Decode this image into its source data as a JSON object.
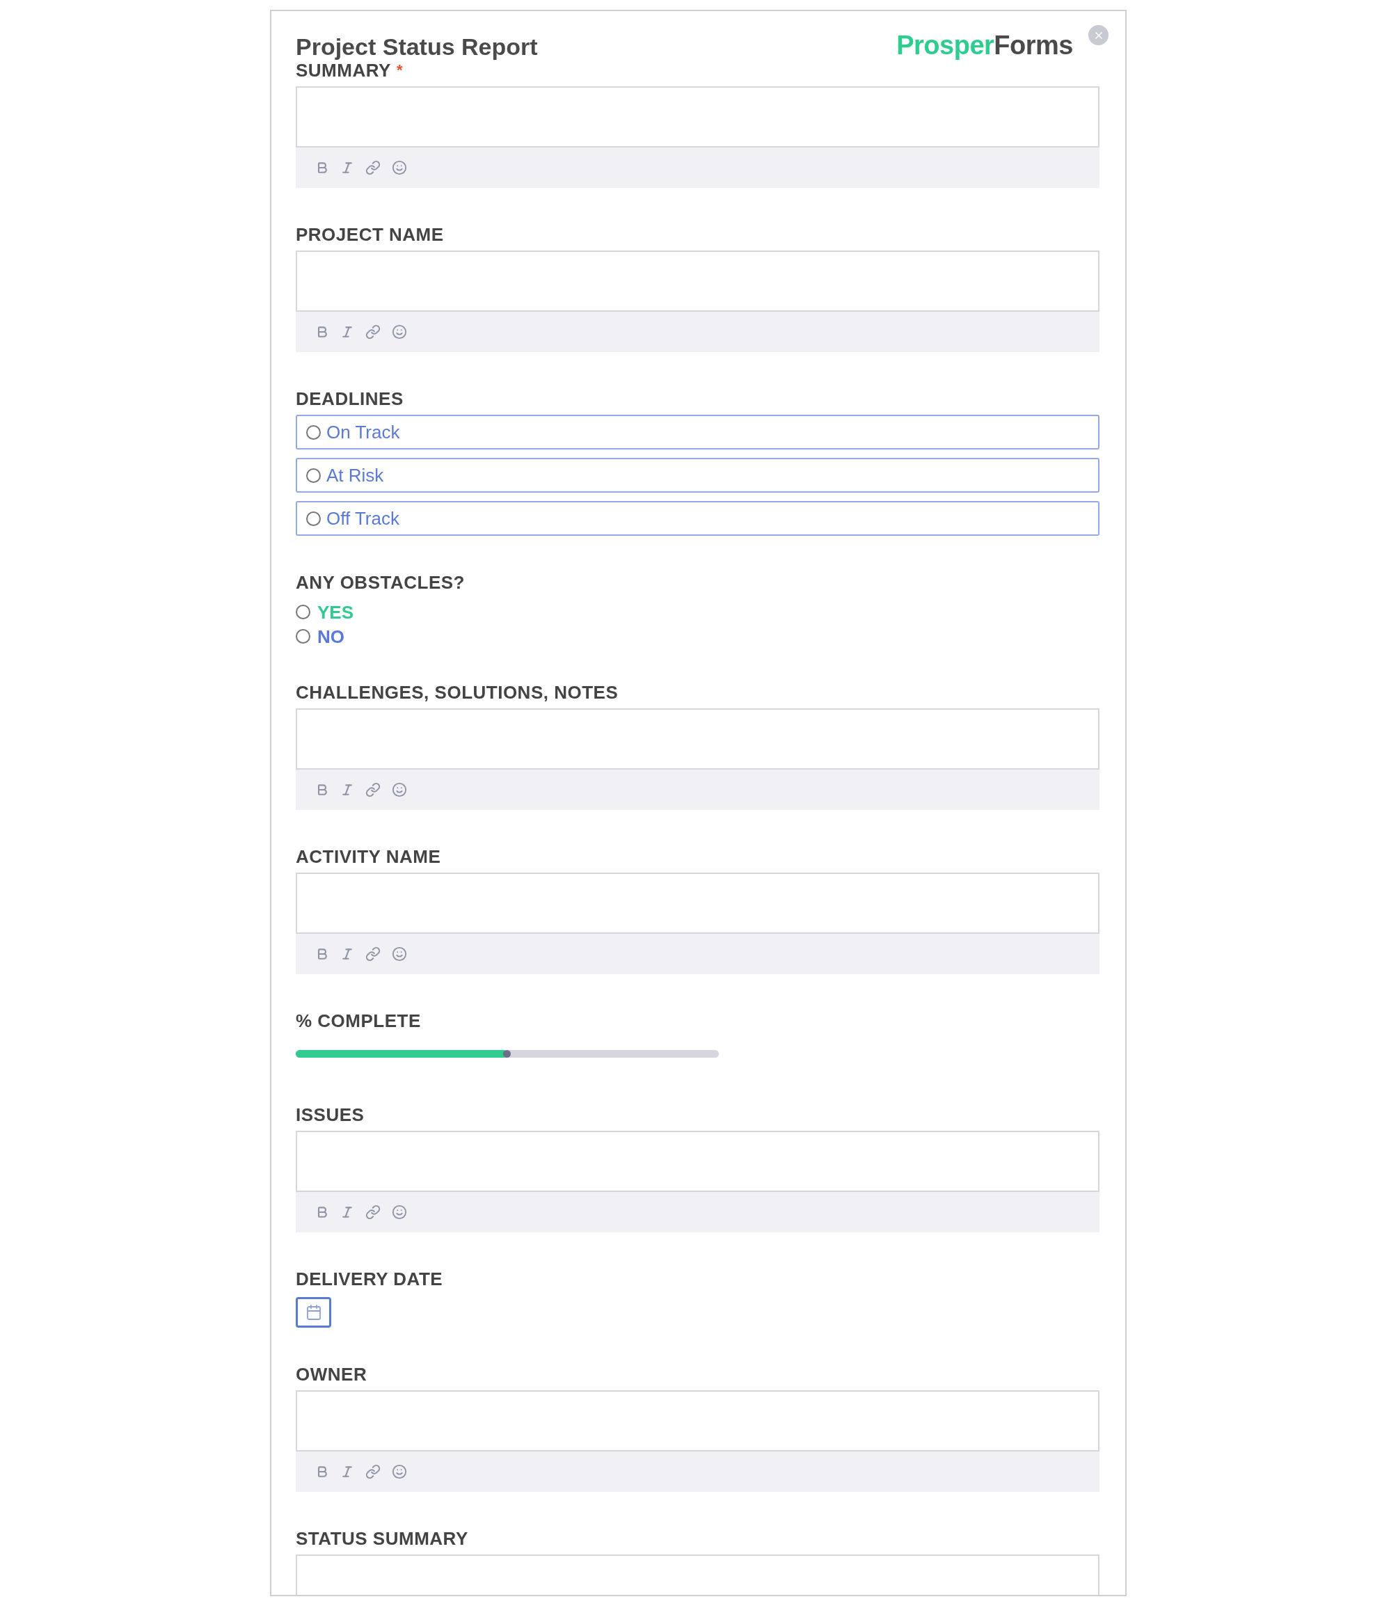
{
  "header": {
    "title": "Project Status Report",
    "logo": {
      "first": "Prosper",
      "second": "Forms"
    }
  },
  "fields": [
    {
      "kind": "richtext",
      "label": "SUMMARY",
      "required_mark": "*"
    },
    {
      "kind": "richtext",
      "label": "PROJECT NAME"
    },
    {
      "kind": "boxed_radio",
      "label": "DEADLINES",
      "options": [
        {
          "label": "On Track",
          "selected": false
        },
        {
          "label": "At Risk",
          "selected": false
        },
        {
          "label": "Off Track",
          "selected": false
        }
      ]
    },
    {
      "kind": "radio",
      "label": "ANY OBSTACLES?",
      "options": [
        {
          "label": "YES",
          "selected": false,
          "color": "#2ecc8f"
        },
        {
          "label": "NO",
          "selected": false,
          "color": "#5b79d6"
        }
      ]
    },
    {
      "kind": "richtext",
      "label": "CHALLENGES, SOLUTIONS, NOTES"
    },
    {
      "kind": "richtext",
      "label": "ACTIVITY NAME"
    },
    {
      "kind": "slider",
      "label": "% COMPLETE",
      "level": 0.5
    },
    {
      "kind": "richtext",
      "label": "ISSUES"
    },
    {
      "kind": "date",
      "label": "DELIVERY DATE"
    },
    {
      "kind": "richtext",
      "label": "OWNER"
    },
    {
      "kind": "richtext",
      "label": "STATUS SUMMARY"
    }
  ]
}
